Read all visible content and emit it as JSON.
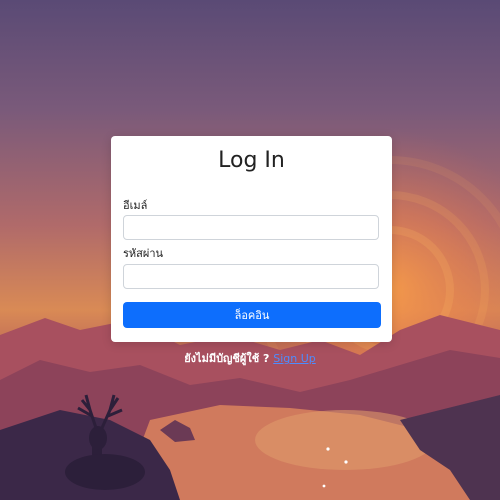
{
  "login": {
    "title": "Log In",
    "email_label": "อีเมล์",
    "email_value": "",
    "password_label": "รหัสผ่าน",
    "password_value": "",
    "submit_label": "ล็อคอิน"
  },
  "signup": {
    "prompt": "ยังไม่มีบัญชีผู้ใช้ ?",
    "link_label": "Sign Up"
  },
  "colors": {
    "primary_button": "#0d6efd",
    "link": "#4e8cff",
    "card": "#ffffff"
  }
}
